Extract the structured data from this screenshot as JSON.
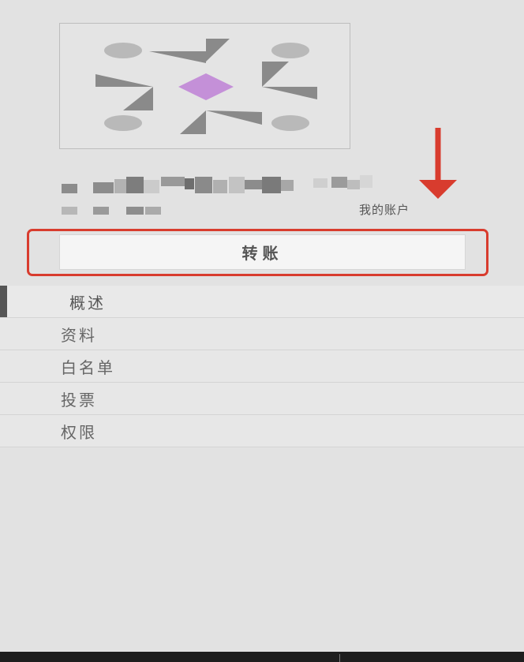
{
  "account": {
    "label": "我的账户"
  },
  "actions": {
    "transfer_label": "转账"
  },
  "menu": {
    "items": [
      {
        "label": "概述",
        "active": true
      },
      {
        "label": "资料",
        "active": false
      },
      {
        "label": "白名单",
        "active": false
      },
      {
        "label": "投票",
        "active": false
      },
      {
        "label": "权限",
        "active": false
      }
    ]
  },
  "colors": {
    "annotation_red": "#d83c2e",
    "identicon_accent": "#c490d8"
  },
  "icons": {
    "identicon": "account-identicon",
    "arrow": "down-arrow-annotation"
  }
}
